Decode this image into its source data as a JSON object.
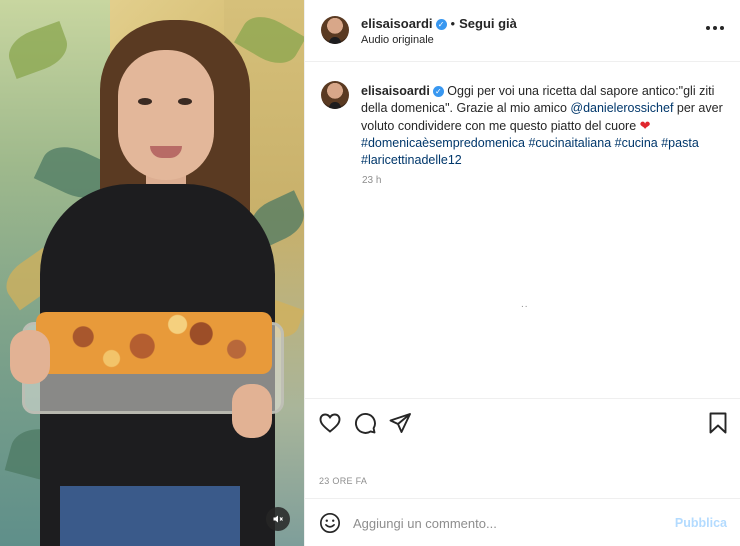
{
  "post": {
    "author": {
      "username": "elisaisoardi",
      "verified_icon": "verified-badge-icon"
    },
    "header": {
      "separator": "•",
      "follow_label": "Segui già",
      "audio_label": "Audio originale",
      "more_icon": "more-options-icon"
    },
    "caption": {
      "text_before_mention": "Oggi per voi una ricetta dal sapore antico:\"gli ziti della domenica\". Grazie al mio amico ",
      "mention": "@danielerossichef",
      "text_after_mention": " per aver voluto condividere con me questo piatto del cuore ",
      "emoji": "❤",
      "hashtags": [
        "#domenicaèsempredomenica",
        "#cucinaitaliana",
        "#cucina",
        "#pasta",
        "#laricettinadelle12"
      ],
      "time": "23 h"
    },
    "loading_indicator": "..",
    "actions": {
      "like_icon": "heart-icon",
      "comment_icon": "comment-icon",
      "share_icon": "send-icon",
      "save_icon": "bookmark-icon"
    },
    "date_label": "23 ORE FA",
    "comment": {
      "emoji_icon": "emoji-icon",
      "placeholder": "Aggiungi un commento...",
      "post_label": "Pubblica"
    }
  },
  "media": {
    "sound_icon": "speaker-muted-icon"
  },
  "colors": {
    "text": "#262626",
    "secondary": "#8e8e8e",
    "link": "#00376b",
    "verified": "#3897f0",
    "post_button_disabled": "#b3dbff",
    "divider": "#efefef"
  }
}
